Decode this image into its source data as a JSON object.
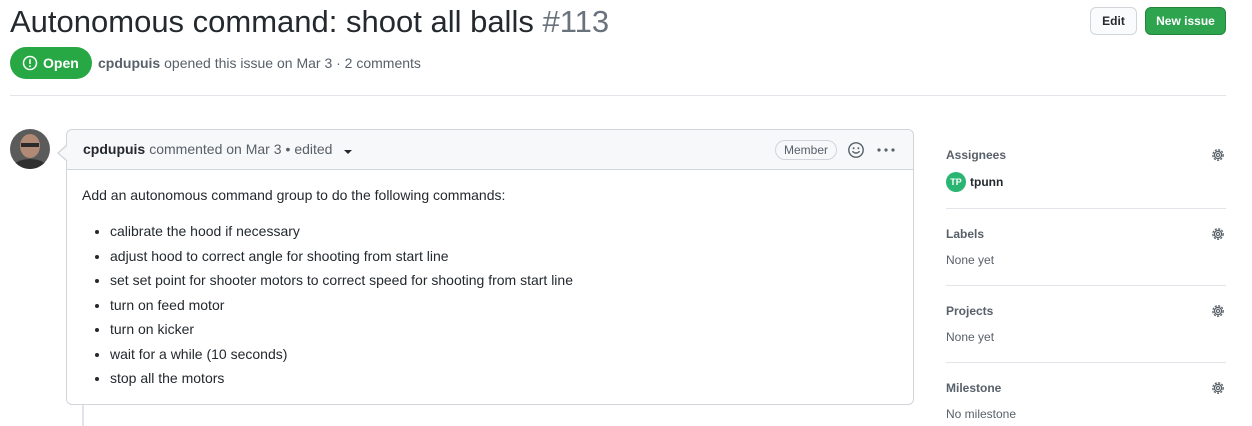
{
  "issue": {
    "title": "Autonomous command: shoot all balls",
    "number": "#113",
    "state": "Open",
    "author": "cpdupuis",
    "meta_text": "opened this issue on Mar 3 · 2 comments"
  },
  "header_actions": {
    "edit_label": "Edit",
    "new_issue_label": "New issue"
  },
  "comment": {
    "author": "cpdupuis",
    "action_text": "commented on Mar 3",
    "edited_text": "• edited",
    "role_badge": "Member",
    "body_intro": "Add an autonomous command group to do the following commands:",
    "items": [
      "calibrate the hood if necessary",
      "adjust hood to correct angle for shooting from start line",
      "set set point for shooter motors to correct speed for shooting from start line",
      "turn on feed motor",
      "turn on kicker",
      "wait for a while (10 seconds)",
      "stop all the motors"
    ]
  },
  "sidebar": {
    "assignees": {
      "heading": "Assignees",
      "user": "tpunn",
      "avatar_initials": "TP"
    },
    "labels": {
      "heading": "Labels",
      "value": "None yet"
    },
    "projects": {
      "heading": "Projects",
      "value": "None yet"
    },
    "milestone": {
      "heading": "Milestone",
      "value": "No milestone"
    }
  },
  "colors": {
    "open_green": "#28a745",
    "new_issue_green": "#2ea44f",
    "assignee_avatar": "#2ab573"
  },
  "icons": [
    "issue-opened-icon",
    "caret-down-icon",
    "smiley-icon",
    "kebab-horizontal-icon",
    "gear-icon"
  ]
}
